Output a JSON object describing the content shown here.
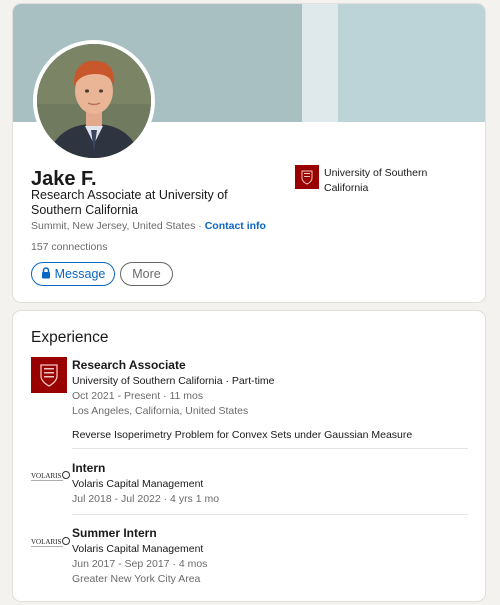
{
  "profile": {
    "name": "Jake F.",
    "name_suffix": "·",
    "headline": "Research Associate at University of Southern California",
    "location": "Summit, New Jersey, United States",
    "location_separator": " · ",
    "contact_info_label": "Contact info",
    "connections": "157 connections",
    "message_label": "Message",
    "more_label": "More",
    "education": {
      "school_name": "University of Southern California"
    },
    "colors": {
      "accent": "#0a66c2",
      "banner": "#a9c0c3",
      "usc_red": "#990000"
    }
  },
  "experience": {
    "section_title": "Experience",
    "items": [
      {
        "title": "Research Associate",
        "company_line": "University of Southern California · Part-time",
        "dates": "Oct 2021 - Present · 11 mos",
        "location": "Los Angeles, California, United States",
        "description": "Reverse Isoperimetry Problem for Convex Sets under Gaussian Measure",
        "logo": "usc-logo"
      },
      {
        "title": "Intern",
        "company_line": "Volaris Capital Management",
        "dates": "Jul 2018 - Jul 2022 · 4 yrs 1 mo",
        "logo": "volaris-logo",
        "logo_text": "VOLARIS"
      },
      {
        "title": "Summer Intern",
        "company_line": "Volaris Capital Management",
        "dates": "Jun 2017 - Sep 2017 · 4 mos",
        "location": "Greater New York City Area",
        "logo": "volaris-logo",
        "logo_text": "VOLARIS"
      }
    ]
  }
}
